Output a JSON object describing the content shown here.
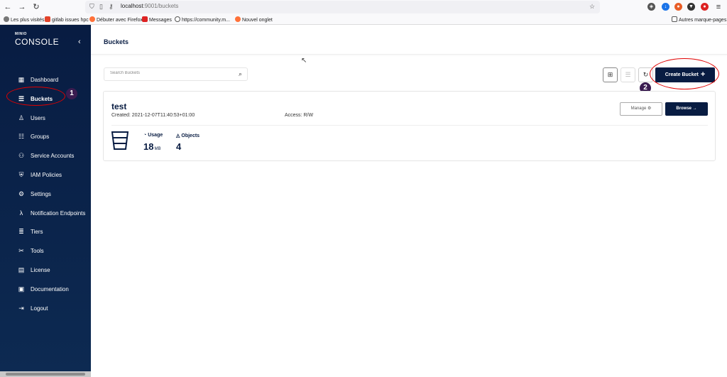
{
  "browser": {
    "url_host": "localhost",
    "url_path": ":9001/buckets",
    "bookmarks": [
      "Les plus visités",
      "gitlab issues hpc",
      "Débuter avec Firefox",
      "Messages",
      "https://community.m...",
      "Nouvel onglet",
      "Autres marque-pages"
    ]
  },
  "sidebar": {
    "logo_top": "MINIO",
    "logo_main": "CONSOLE",
    "items": [
      {
        "label": "Dashboard",
        "icon": "dashboard-icon"
      },
      {
        "label": "Buckets",
        "icon": "bucket-icon"
      },
      {
        "label": "Users",
        "icon": "user-icon"
      },
      {
        "label": "Groups",
        "icon": "groups-icon"
      },
      {
        "label": "Service Accounts",
        "icon": "service-accounts-icon"
      },
      {
        "label": "IAM Policies",
        "icon": "shield-icon"
      },
      {
        "label": "Settings",
        "icon": "gear-icon"
      },
      {
        "label": "Notification Endpoints",
        "icon": "lambda-icon"
      },
      {
        "label": "Tiers",
        "icon": "tiers-icon"
      },
      {
        "label": "Tools",
        "icon": "tools-icon"
      },
      {
        "label": "License",
        "icon": "license-icon"
      },
      {
        "label": "Documentation",
        "icon": "documentation-icon"
      },
      {
        "label": "Logout",
        "icon": "logout-icon"
      }
    ],
    "active": "Buckets"
  },
  "annotations": {
    "badge1": "1",
    "badge2": "2",
    "accent": "#e00000"
  },
  "header": {
    "title": "Buckets"
  },
  "toolbar": {
    "search_placeholder": "Search Buckets",
    "create_label": "Create Bucket",
    "create_plus": "+"
  },
  "bucket": {
    "name": "test",
    "created": "Created: 2021-12-07T11:40:53+01:00",
    "access": "Access: R/W",
    "manage_label": "Manage",
    "browse_label": "Browse",
    "usage_label": "Usage",
    "usage_value": "18",
    "usage_unit": "MB",
    "objects_label": "Objects",
    "objects_value": "4"
  },
  "colors": {
    "brand": "#081c42"
  }
}
